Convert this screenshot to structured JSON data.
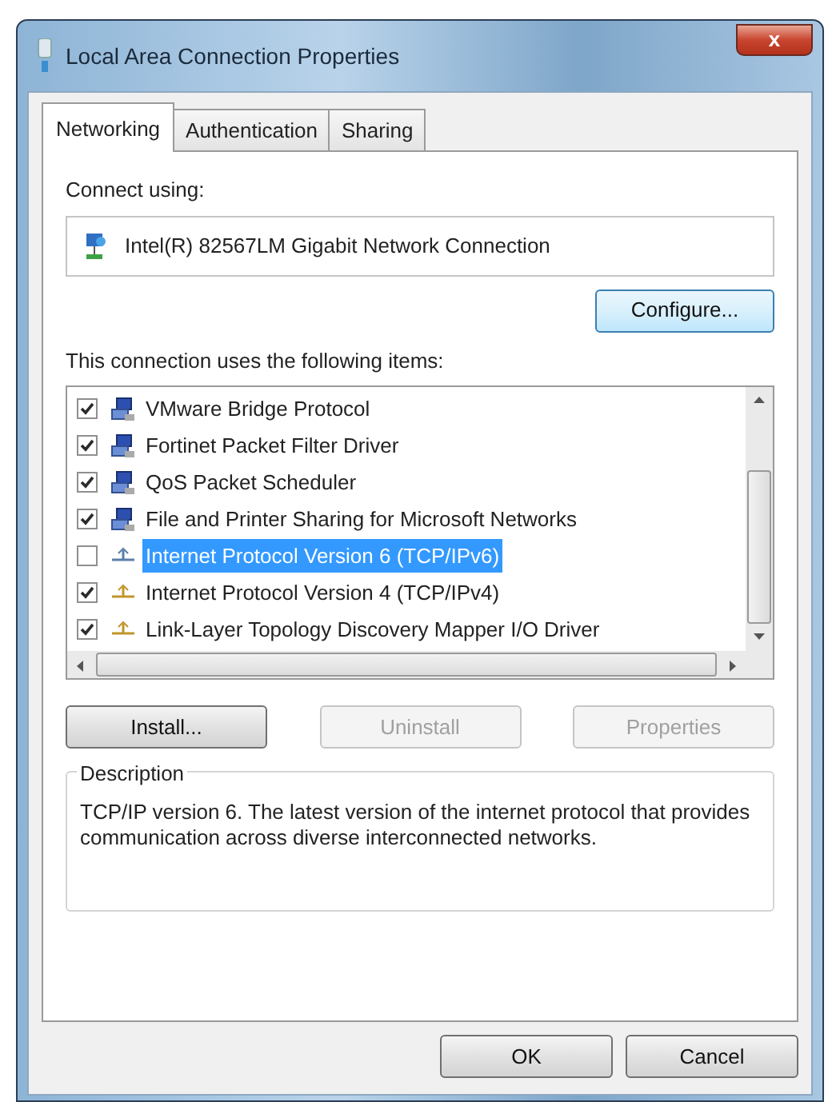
{
  "window": {
    "title": "Local Area Connection Properties",
    "close_glyph": "x"
  },
  "tabs": [
    {
      "label": "Networking",
      "selected": true
    },
    {
      "label": "Authentication",
      "selected": false
    },
    {
      "label": "Sharing",
      "selected": false
    }
  ],
  "connect_using": {
    "label": "Connect using:",
    "adapter": "Intel(R) 82567LM Gigabit Network Connection",
    "configure_button": "Configure..."
  },
  "items_label": "This connection uses the following items:",
  "items": [
    {
      "name": "VMware Bridge Protocol",
      "kind": "service",
      "checked": true,
      "selected": false
    },
    {
      "name": "Fortinet Packet Filter Driver",
      "kind": "service",
      "checked": true,
      "selected": false
    },
    {
      "name": "QoS Packet Scheduler",
      "kind": "service",
      "checked": true,
      "selected": false
    },
    {
      "name": "File and Printer Sharing for Microsoft Networks",
      "kind": "service",
      "checked": true,
      "selected": false
    },
    {
      "name": "Internet Protocol Version 6 (TCP/IPv6)",
      "kind": "protocol",
      "checked": false,
      "selected": true
    },
    {
      "name": "Internet Protocol Version 4 (TCP/IPv4)",
      "kind": "protocol",
      "checked": true,
      "selected": false
    },
    {
      "name": "Link-Layer Topology Discovery Mapper I/O Driver",
      "kind": "protocol",
      "checked": true,
      "selected": false
    }
  ],
  "item_buttons": [
    {
      "label": "Install...",
      "disabled": false
    },
    {
      "label": "Uninstall",
      "disabled": true
    },
    {
      "label": "Properties",
      "disabled": true
    }
  ],
  "description": {
    "title": "Description",
    "text": "TCP/IP version 6. The latest version of the internet protocol that provides communication across diverse interconnected networks."
  },
  "dialog_buttons": [
    {
      "label": "OK"
    },
    {
      "label": "Cancel"
    }
  ]
}
